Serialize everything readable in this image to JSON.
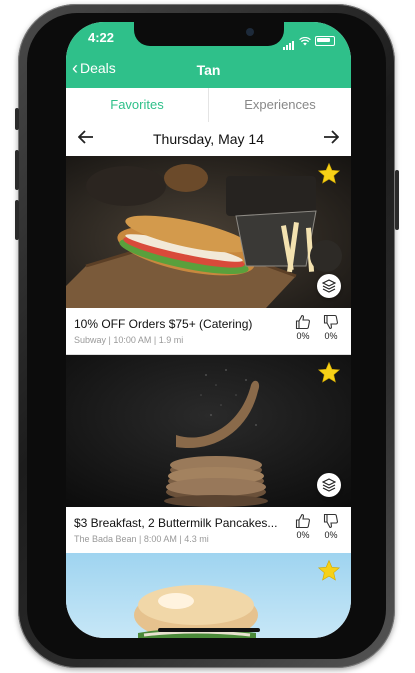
{
  "status_bar": {
    "time": "4:22"
  },
  "nav": {
    "back_label": "Deals",
    "title": "Tan"
  },
  "tabs": [
    {
      "label": "Favorites",
      "active": true
    },
    {
      "label": "Experiences",
      "active": false
    }
  ],
  "date_bar": {
    "date": "Thursday, May 14"
  },
  "deals": [
    {
      "title": "10% OFF Orders $75+ (Catering)",
      "meta": "Subway | 10:00 AM | 1.9 mi",
      "thumbs_up": "0%",
      "thumbs_down": "0%",
      "image": "sandwich-photo"
    },
    {
      "title": "$3 Breakfast, 2 Buttermilk Pancakes...",
      "meta": "The Bada Bean | 8:00 AM | 4.3 mi",
      "thumbs_up": "0%",
      "thumbs_down": "0%",
      "image": "pancake-photo"
    },
    {
      "image": "burger-photo"
    }
  ],
  "colors": {
    "brand": "#2fc08a",
    "star": "#f7d117"
  }
}
